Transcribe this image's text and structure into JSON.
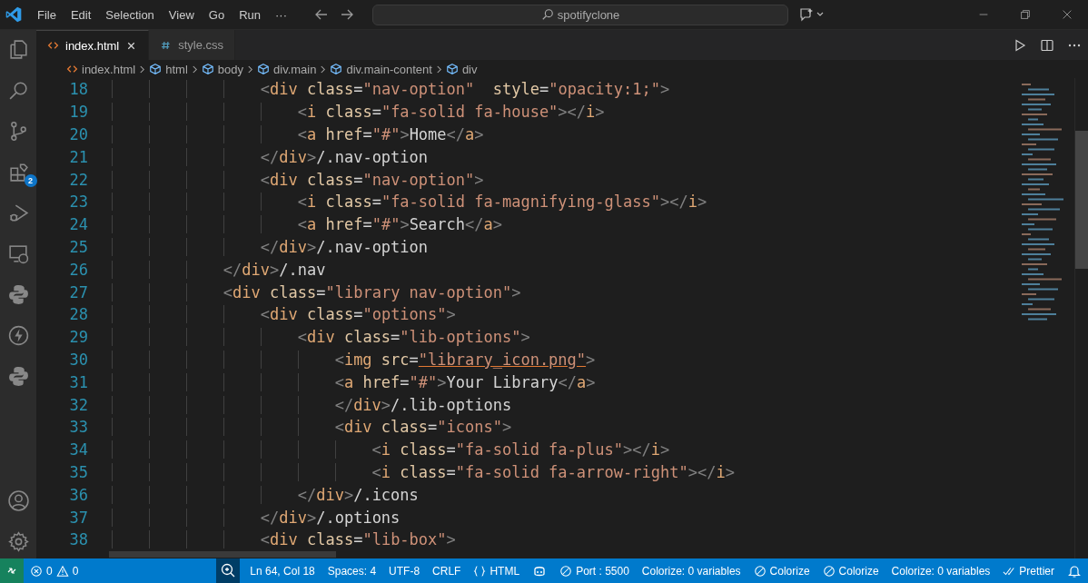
{
  "menu": [
    "File",
    "Edit",
    "Selection",
    "View",
    "Go",
    "Run",
    "···"
  ],
  "search": {
    "value": "spotifyclone"
  },
  "tabs": [
    {
      "label": "index.html",
      "kind": "html",
      "selected": true
    },
    {
      "label": "style.css",
      "kind": "css",
      "selected": false
    }
  ],
  "breadcrumb": [
    {
      "label": "index.html",
      "kind": "file"
    },
    {
      "label": "html",
      "kind": "element"
    },
    {
      "label": "body",
      "kind": "element"
    },
    {
      "label": "div.main",
      "kind": "element"
    },
    {
      "label": "div.main-content",
      "kind": "element"
    },
    {
      "label": "div",
      "kind": "element"
    }
  ],
  "activity_bar": {
    "extensions_badge": "2"
  },
  "lines": [
    {
      "number": "18",
      "text": "                <div class=\"nav-option\"  style=\"opacity:1;\">"
    },
    {
      "number": "19",
      "text": "                    <i class=\"fa-solid fa-house\"></i>"
    },
    {
      "number": "20",
      "text": "                    <a href=\"#\">Home</a>"
    },
    {
      "number": "21",
      "text": "                </div>/.nav-option"
    },
    {
      "number": "22",
      "text": "                <div class=\"nav-option\">"
    },
    {
      "number": "23",
      "text": "                    <i class=\"fa-solid fa-magnifying-glass\"></i>"
    },
    {
      "number": "24",
      "text": "                    <a href=\"#\">Search</a>"
    },
    {
      "number": "25",
      "text": "                </div>/.nav-option"
    },
    {
      "number": "26",
      "text": "            </div>/.nav"
    },
    {
      "number": "27",
      "text": "            <div class=\"library nav-option\">"
    },
    {
      "number": "28",
      "text": "                <div class=\"options\">"
    },
    {
      "number": "29",
      "text": "                    <div class=\"lib-options\">"
    },
    {
      "number": "30",
      "text": "                        <img src=\"library_icon.png\">",
      "underline": true
    },
    {
      "number": "31",
      "text": "                        <a href=\"#\">Your Library</a>"
    },
    {
      "number": "32",
      "text": "                        </div>/.lib-options"
    },
    {
      "number": "33",
      "text": "                        <div class=\"icons\">"
    },
    {
      "number": "34",
      "text": "                            <i class=\"fa-solid fa-plus\"></i>"
    },
    {
      "number": "35",
      "text": "                            <i class=\"fa-solid fa-arrow-right\"></i>"
    },
    {
      "number": "36",
      "text": "                    </div>/.icons"
    },
    {
      "number": "37",
      "text": "                </div>/.options"
    },
    {
      "number": "38",
      "text": "                <div class=\"lib-box\">"
    }
  ],
  "status_bar": {
    "errors": "0",
    "warnings": "0",
    "items": [
      {
        "kind": "plain",
        "text": "Ln 64, Col 18"
      },
      {
        "kind": "plain",
        "text": "Spaces: 4"
      },
      {
        "kind": "plain",
        "text": "UTF-8"
      },
      {
        "kind": "plain",
        "text": "CRLF"
      },
      {
        "kind": "language",
        "text": "HTML"
      },
      {
        "kind": "copilot"
      },
      {
        "kind": "blocked",
        "text": "Port : 5500"
      },
      {
        "kind": "plain",
        "text": "Colorize: 0 variables"
      },
      {
        "kind": "blocked",
        "text": "Colorize"
      },
      {
        "kind": "blocked",
        "text": "Colorize"
      },
      {
        "kind": "plain",
        "text": "Colorize: 0 variables"
      },
      {
        "kind": "formatter",
        "text": "Prettier"
      },
      {
        "kind": "bell"
      }
    ]
  }
}
